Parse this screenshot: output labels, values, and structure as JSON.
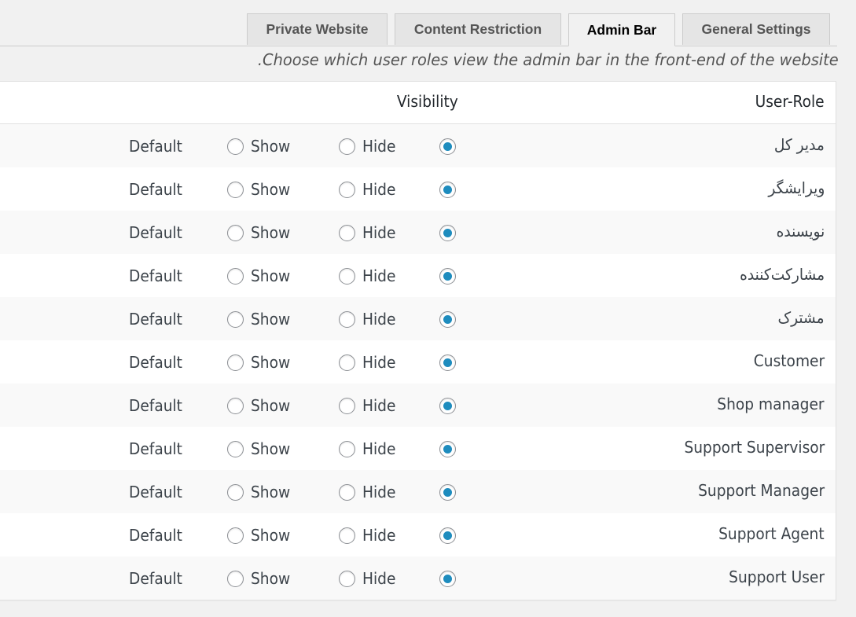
{
  "tabs": [
    {
      "label": "Private Website",
      "active": false
    },
    {
      "label": "Content Restriction",
      "active": false
    },
    {
      "label": "Admin Bar",
      "active": true
    },
    {
      "label": "General Settings",
      "active": false
    }
  ],
  "description": ".Choose which user roles view the admin bar in the front-end of the website",
  "table": {
    "header_role": "User-Role",
    "header_visibility": "Visibility",
    "option_default": "Default",
    "option_show": "Show",
    "option_hide": "Hide",
    "rows": [
      {
        "role": "مدیر کل",
        "selected": "default"
      },
      {
        "role": "ویرایشگر",
        "selected": "default"
      },
      {
        "role": "نویسنده",
        "selected": "default"
      },
      {
        "role": "مشارکت‌کننده",
        "selected": "default"
      },
      {
        "role": "مشترک",
        "selected": "default"
      },
      {
        "role": "Customer",
        "selected": "default"
      },
      {
        "role": "Shop manager",
        "selected": "default"
      },
      {
        "role": "Support Supervisor",
        "selected": "default"
      },
      {
        "role": "Support Manager",
        "selected": "default"
      },
      {
        "role": "Support Agent",
        "selected": "default"
      },
      {
        "role": "Support User",
        "selected": "default"
      }
    ]
  },
  "colors": {
    "accent": "#1e8cbe",
    "background": "#f1f1f1",
    "row_alt": "#f9f9f9"
  }
}
